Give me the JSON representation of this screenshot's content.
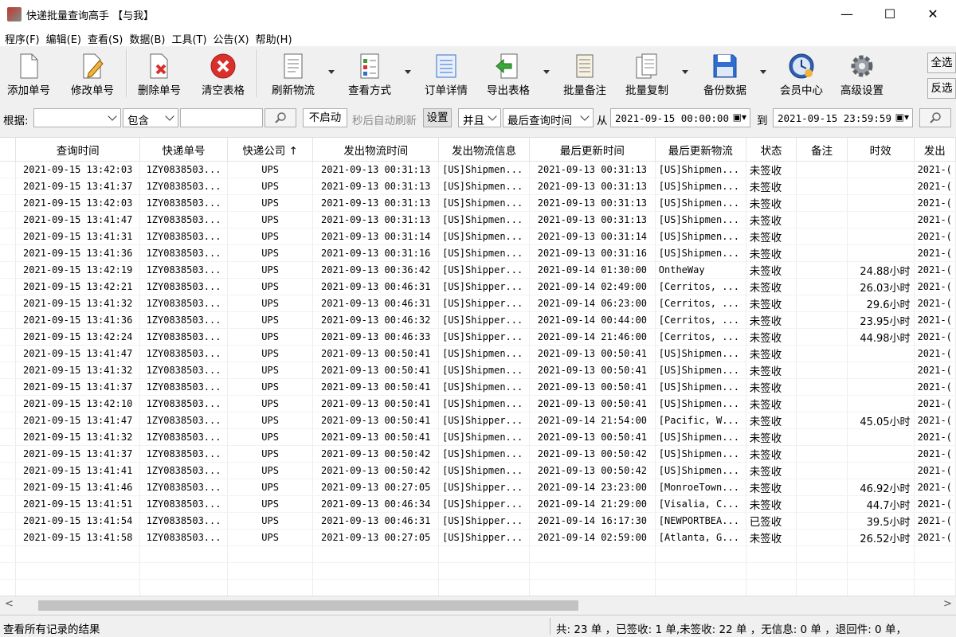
{
  "window": {
    "title": "快递批量查询高手 【与我】",
    "minimize": "—",
    "maximize": "☐",
    "close": "✕"
  },
  "menu": [
    "程序(F)",
    "编辑(E)",
    "查看(S)",
    "数据(B)",
    "工具(T)",
    "公告(X)",
    "帮助(H)"
  ],
  "toolbar": {
    "add": "添加单号",
    "edit": "修改单号",
    "delete": "删除单号",
    "clear": "清空表格",
    "refresh": "刷新物流",
    "view_mode": "查看方式",
    "detail": "订单详情",
    "export": "导出表格",
    "batch_note": "批量备注",
    "batch_copy": "批量复制",
    "backup": "备份数据",
    "member": "会员中心",
    "advanced": "高级设置",
    "select_all": "全选",
    "invert": "反选"
  },
  "filter": {
    "by_label": "根据:",
    "by_value": "",
    "match_value": "包含",
    "keyword": "",
    "auto_button": "不启动",
    "auto_hint": "秒后自动刷新",
    "settings": "设置",
    "logic": "并且",
    "time_field": "最后查询时间",
    "from_label": "从",
    "from": "2021-09-15 00:00:00",
    "to_label": "到",
    "to": "2021-09-15 23:59:59"
  },
  "columns": [
    "查询时间",
    "快递单号",
    "快递公司 ↑",
    "发出物流时间",
    "发出物流信息",
    "最后更新时间",
    "最后更新物流",
    "状态",
    "备注",
    "时效",
    "发出"
  ],
  "rows": [
    [
      "2021-09-15 13:42:03",
      "1ZY0838503...",
      "UPS",
      "2021-09-13 00:31:13",
      "[US]Shipmen...",
      "2021-09-13 00:31:13",
      "[US]Shipmen...",
      "未签收",
      "",
      "",
      "2021-("
    ],
    [
      "2021-09-15 13:41:37",
      "1ZY0838503...",
      "UPS",
      "2021-09-13 00:31:13",
      "[US]Shipmen...",
      "2021-09-13 00:31:13",
      "[US]Shipmen...",
      "未签收",
      "",
      "",
      "2021-("
    ],
    [
      "2021-09-15 13:42:03",
      "1ZY0838503...",
      "UPS",
      "2021-09-13 00:31:13",
      "[US]Shipmen...",
      "2021-09-13 00:31:13",
      "[US]Shipmen...",
      "未签收",
      "",
      "",
      "2021-("
    ],
    [
      "2021-09-15 13:41:47",
      "1ZY0838503...",
      "UPS",
      "2021-09-13 00:31:13",
      "[US]Shipmen...",
      "2021-09-13 00:31:13",
      "[US]Shipmen...",
      "未签收",
      "",
      "",
      "2021-("
    ],
    [
      "2021-09-15 13:41:31",
      "1ZY0838503...",
      "UPS",
      "2021-09-13 00:31:14",
      "[US]Shipmen...",
      "2021-09-13 00:31:14",
      "[US]Shipmen...",
      "未签收",
      "",
      "",
      "2021-("
    ],
    [
      "2021-09-15 13:41:36",
      "1ZY0838503...",
      "UPS",
      "2021-09-13 00:31:16",
      "[US]Shipmen...",
      "2021-09-13 00:31:16",
      "[US]Shipmen...",
      "未签收",
      "",
      "",
      "2021-("
    ],
    [
      "2021-09-15 13:42:19",
      "1ZY0838503...",
      "UPS",
      "2021-09-13 00:36:42",
      "[US]Shipper...",
      "2021-09-14 01:30:00",
      "OntheWay",
      "未签收",
      "",
      "24.88小时",
      "2021-("
    ],
    [
      "2021-09-15 13:42:21",
      "1ZY0838503...",
      "UPS",
      "2021-09-13 00:46:31",
      "[US]Shipper...",
      "2021-09-14 02:49:00",
      "[Cerritos, ...",
      "未签收",
      "",
      "26.03小时",
      "2021-("
    ],
    [
      "2021-09-15 13:41:32",
      "1ZY0838503...",
      "UPS",
      "2021-09-13 00:46:31",
      "[US]Shipper...",
      "2021-09-14 06:23:00",
      "[Cerritos, ...",
      "未签收",
      "",
      "29.6小时",
      "2021-("
    ],
    [
      "2021-09-15 13:41:36",
      "1ZY0838503...",
      "UPS",
      "2021-09-13 00:46:32",
      "[US]Shipper...",
      "2021-09-14 00:44:00",
      "[Cerritos, ...",
      "未签收",
      "",
      "23.95小时",
      "2021-("
    ],
    [
      "2021-09-15 13:42:24",
      "1ZY0838503...",
      "UPS",
      "2021-09-13 00:46:33",
      "[US]Shipper...",
      "2021-09-14 21:46:00",
      "[Cerritos, ...",
      "未签收",
      "",
      "44.98小时",
      "2021-("
    ],
    [
      "2021-09-15 13:41:47",
      "1ZY0838503...",
      "UPS",
      "2021-09-13 00:50:41",
      "[US]Shipmen...",
      "2021-09-13 00:50:41",
      "[US]Shipmen...",
      "未签收",
      "",
      "",
      "2021-("
    ],
    [
      "2021-09-15 13:41:32",
      "1ZY0838503...",
      "UPS",
      "2021-09-13 00:50:41",
      "[US]Shipmen...",
      "2021-09-13 00:50:41",
      "[US]Shipmen...",
      "未签收",
      "",
      "",
      "2021-("
    ],
    [
      "2021-09-15 13:41:37",
      "1ZY0838503...",
      "UPS",
      "2021-09-13 00:50:41",
      "[US]Shipmen...",
      "2021-09-13 00:50:41",
      "[US]Shipmen...",
      "未签收",
      "",
      "",
      "2021-("
    ],
    [
      "2021-09-15 13:42:10",
      "1ZY0838503...",
      "UPS",
      "2021-09-13 00:50:41",
      "[US]Shipmen...",
      "2021-09-13 00:50:41",
      "[US]Shipmen...",
      "未签收",
      "",
      "",
      "2021-("
    ],
    [
      "2021-09-15 13:41:47",
      "1ZY0838503...",
      "UPS",
      "2021-09-13 00:50:41",
      "[US]Shipper...",
      "2021-09-14 21:54:00",
      "[Pacific, W...",
      "未签收",
      "",
      "45.05小时",
      "2021-("
    ],
    [
      "2021-09-15 13:41:32",
      "1ZY0838503...",
      "UPS",
      "2021-09-13 00:50:41",
      "[US]Shipmen...",
      "2021-09-13 00:50:41",
      "[US]Shipmen...",
      "未签收",
      "",
      "",
      "2021-("
    ],
    [
      "2021-09-15 13:41:37",
      "1ZY0838503...",
      "UPS",
      "2021-09-13 00:50:42",
      "[US]Shipmen...",
      "2021-09-13 00:50:42",
      "[US]Shipmen...",
      "未签收",
      "",
      "",
      "2021-("
    ],
    [
      "2021-09-15 13:41:41",
      "1ZY0838503...",
      "UPS",
      "2021-09-13 00:50:42",
      "[US]Shipmen...",
      "2021-09-13 00:50:42",
      "[US]Shipmen...",
      "未签收",
      "",
      "",
      "2021-("
    ],
    [
      "2021-09-15 13:41:46",
      "1ZY0838503...",
      "UPS",
      "2021-09-13 00:27:05",
      "[US]Shipper...",
      "2021-09-14 23:23:00",
      "[MonroeTown...",
      "未签收",
      "",
      "46.92小时",
      "2021-("
    ],
    [
      "2021-09-15 13:41:51",
      "1ZY0838503...",
      "UPS",
      "2021-09-13 00:46:34",
      "[US]Shipper...",
      "2021-09-14 21:29:00",
      "[Visalia, C...",
      "未签收",
      "",
      "44.7小时",
      "2021-("
    ],
    [
      "2021-09-15 13:41:54",
      "1ZY0838503...",
      "UPS",
      "2021-09-13 00:46:31",
      "[US]Shipper...",
      "2021-09-14 16:17:30",
      "[NEWPORTBEA...",
      "已签收",
      "",
      "39.5小时",
      "2021-("
    ],
    [
      "2021-09-15 13:41:58",
      "1ZY0838503...",
      "UPS",
      "2021-09-13 00:27:05",
      "[US]Shipper...",
      "2021-09-14 02:59:00",
      "[Atlanta, G...",
      "未签收",
      "",
      "26.52小时",
      "2021-("
    ]
  ],
  "status": {
    "left": "查看所有记录的结果",
    "right": "共: 23 单 ，已签收:  1 单,未签收:  22 单 ，无信息: 0 单 ，退回件: 0 单，"
  },
  "colors": {
    "accent": "#0078d7",
    "delete_red": "#d9302c"
  }
}
